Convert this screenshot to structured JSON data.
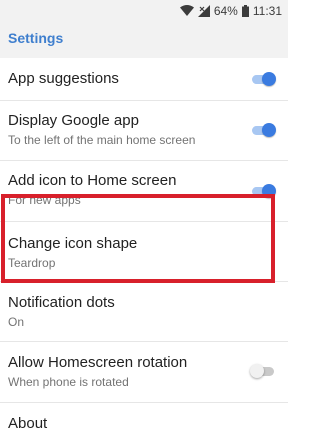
{
  "status_bar": {
    "battery_percent": "64%",
    "time": "11:31",
    "icons": [
      "wifi-icon",
      "cell-signal-icon",
      "battery-icon"
    ]
  },
  "app_bar": {
    "title": "Settings"
  },
  "settings": [
    {
      "title": "App suggestions",
      "summary": "",
      "toggle": "on"
    },
    {
      "title": "Display Google app",
      "summary": "To the left of the main home screen",
      "toggle": "on"
    },
    {
      "title": "Add icon to Home screen",
      "summary": "For new apps",
      "toggle": "on"
    },
    {
      "title": "Change icon shape",
      "summary": "Teardrop",
      "toggle": "none"
    },
    {
      "title": "Notification dots",
      "summary": "On",
      "toggle": "none"
    },
    {
      "title": "Allow Homescreen rotation",
      "summary": "When phone is rotated",
      "toggle": "off"
    },
    {
      "title": "About",
      "summary": "",
      "toggle": "none"
    }
  ],
  "colors": {
    "accent": "#3a7be0",
    "title_accent": "#3f7fce",
    "highlight": "#d8202b"
  }
}
